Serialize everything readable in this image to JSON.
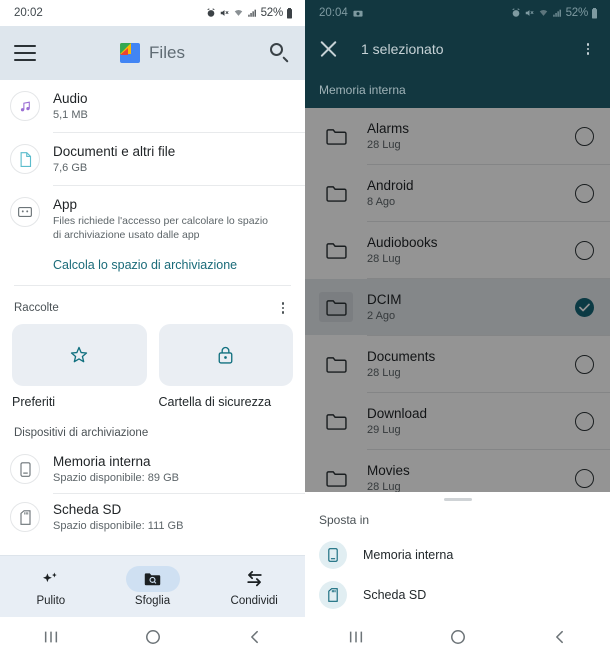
{
  "left": {
    "statusbar": {
      "time": "20:02",
      "battery": "52%",
      "icons": [
        "alarm-icon",
        "mute-icon",
        "wifi-icon",
        "signal-icon",
        "battery-icon"
      ]
    },
    "appbar": {
      "title": "Files",
      "menu_icon": "hamburger-icon",
      "logo_icon": "files-logo-icon",
      "search_icon": "search-icon"
    },
    "categories": [
      {
        "title": "Audio",
        "subtitle": "5,1 MB",
        "icon": "music-note-icon"
      },
      {
        "title": "Documenti e altri file",
        "subtitle": "7,6 GB",
        "icon": "document-icon"
      },
      {
        "title": "App",
        "subtitle": "Files richiede l'accesso per calcolare lo spazio di archiviazione usato dalle app",
        "icon": "apps-icon"
      }
    ],
    "calc_link": "Calcola lo spazio di archiviazione",
    "collections": {
      "section_title": "Raccolte",
      "menu_icon": "kebab-menu-icon",
      "items": [
        {
          "label": "Preferiti",
          "icon": "star-icon"
        },
        {
          "label": "Cartella di sicurezza",
          "icon": "lock-icon"
        }
      ]
    },
    "storage": {
      "section_title": "Dispositivi di archiviazione",
      "items": [
        {
          "title": "Memoria interna",
          "subtitle": "Spazio disponibile: 89 GB",
          "icon": "phone-icon"
        },
        {
          "title": "Scheda SD",
          "subtitle": "Spazio disponibile: 111 GB",
          "icon": "sd-card-icon"
        }
      ]
    },
    "bottom_nav": [
      {
        "label": "Pulito",
        "icon": "sparkle-icon",
        "active": false
      },
      {
        "label": "Sfoglia",
        "icon": "browse-folder-icon",
        "active": true
      },
      {
        "label": "Condividi",
        "icon": "share-arrows-icon",
        "active": false
      }
    ],
    "system_nav": [
      "recents-icon",
      "home-icon",
      "back-icon"
    ]
  },
  "right": {
    "statusbar": {
      "time": "20:04",
      "battery": "52%",
      "icons": [
        "camera-icon",
        "alarm-icon",
        "mute-icon",
        "wifi-icon",
        "signal-icon",
        "battery-icon"
      ]
    },
    "appbar": {
      "close_icon": "close-icon",
      "title": "1 selezionato",
      "menu_icon": "kebab-menu-icon"
    },
    "breadcrumb": "Memoria interna",
    "files": [
      {
        "name": "Alarms",
        "date": "28 Lug",
        "selected": false,
        "icon": "folder-icon"
      },
      {
        "name": "Android",
        "date": "8 Ago",
        "selected": false,
        "icon": "folder-icon"
      },
      {
        "name": "Audiobooks",
        "date": "28 Lug",
        "selected": false,
        "icon": "folder-icon"
      },
      {
        "name": "DCIM",
        "date": "2 Ago",
        "selected": true,
        "icon": "folder-icon"
      },
      {
        "name": "Documents",
        "date": "28 Lug",
        "selected": false,
        "icon": "folder-icon"
      },
      {
        "name": "Download",
        "date": "29 Lug",
        "selected": false,
        "icon": "folder-icon"
      },
      {
        "name": "Movies",
        "date": "28 Lug",
        "selected": false,
        "icon": "folder-icon"
      }
    ],
    "sheet": {
      "title": "Sposta in",
      "options": [
        {
          "label": "Memoria interna",
          "icon": "phone-icon"
        },
        {
          "label": "Scheda SD",
          "icon": "sd-card-icon"
        }
      ]
    },
    "system_nav": [
      "recents-icon",
      "home-icon",
      "back-icon"
    ]
  },
  "colors": {
    "left_appbar": "#dee6ed",
    "right_header": "#123740",
    "accent_teal": "#136476",
    "link": "#1a6b79",
    "nav_active_pill": "#cfe0f2"
  }
}
